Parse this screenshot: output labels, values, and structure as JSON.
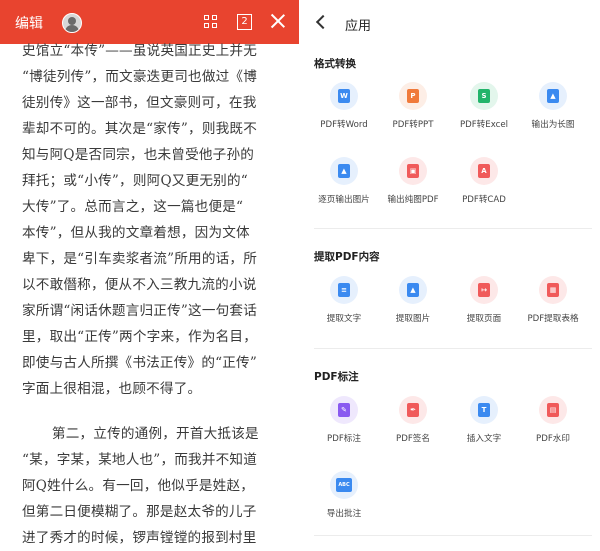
{
  "left": {
    "edit_label": "编辑",
    "page_number": "2",
    "paragraph1": [
      "史馆立“本传”——虽说英国正史上并无",
      "“博徒列传”，而文豪迭更司也做过《博",
      "徒别传》这一部书，但文豪则可，在我",
      "辈却不可的。其次是“家传”，则我既不",
      "知与阿Q是否同宗，也未曾受他子孙的",
      "拜托；或“小传”，则阿Q又更无别的“",
      "大传”了。总而言之，这一篇也便是“",
      "本传”，但从我的文章着想，因为文体",
      "卑下，是“引车卖浆者流”所用的话，所",
      "以不敢僭称，便从不入三教九流的小说",
      "家所谓“闲话休题言归正传”这一句套话",
      "里，取出“正传”两个字来，作为名目，",
      "即使与古人所撰《书法正传》的“正传”",
      "字面上很相混，也顾不得了。"
    ],
    "paragraph2": [
      "第二，立传的通例，开首大抵该是",
      "“某，字某，某地人也”，而我并不知道",
      "阿Q姓什么。有一回，他似乎是姓赵，",
      "但第二日便模糊了。那是赵太爷的儿子",
      "进了秀才的时候，锣声镗镗的报到村里"
    ]
  },
  "right": {
    "title": "应用",
    "sections": [
      {
        "title": "格式转换",
        "tools": [
          {
            "label": "PDF转Word",
            "icon": "word-doc-icon",
            "glyph": "W",
            "color": "#3b8af0",
            "bg": "#e6f0fd"
          },
          {
            "label": "PDF转PPT",
            "icon": "ppt-doc-icon",
            "glyph": "P",
            "color": "#f07a3b",
            "bg": "#fdeee6"
          },
          {
            "label": "PDF转Excel",
            "icon": "excel-doc-icon",
            "glyph": "S",
            "color": "#22b46a",
            "bg": "#e3f6ec"
          },
          {
            "label": "输出为长图",
            "icon": "long-image-icon",
            "glyph": "▲",
            "color": "#3b8af0",
            "bg": "#e6f0fd"
          },
          {
            "label": "逐页输出图片",
            "icon": "page-images-icon",
            "glyph": "▲",
            "color": "#3b8af0",
            "bg": "#e6f0fd"
          },
          {
            "label": "输出纯图PDF",
            "icon": "image-pdf-icon",
            "glyph": "▣",
            "color": "#f05a5a",
            "bg": "#fde8e8"
          },
          {
            "label": "PDF转CAD",
            "icon": "cad-doc-icon",
            "glyph": "A",
            "color": "#f05a5a",
            "bg": "#fde8e8"
          }
        ]
      },
      {
        "title": "提取PDF内容",
        "tools": [
          {
            "label": "提取文字",
            "icon": "extract-text-icon",
            "glyph": "≡",
            "color": "#3b8af0",
            "bg": "#e6f0fd"
          },
          {
            "label": "提取图片",
            "icon": "extract-image-icon",
            "glyph": "▲",
            "color": "#3b8af0",
            "bg": "#e6f0fd"
          },
          {
            "label": "提取页面",
            "icon": "extract-page-icon",
            "glyph": "↦",
            "color": "#f05a5a",
            "bg": "#fde8e8"
          },
          {
            "label": "PDF提取表格",
            "icon": "extract-table-icon",
            "glyph": "▦",
            "color": "#f05a5a",
            "bg": "#fde8e8"
          }
        ]
      },
      {
        "title": "PDF标注",
        "tools": [
          {
            "label": "PDF标注",
            "icon": "annotate-icon",
            "glyph": "✎",
            "color": "#8a5af0",
            "bg": "#efe8fd"
          },
          {
            "label": "PDF签名",
            "icon": "signature-icon",
            "glyph": "✒",
            "color": "#f05a5a",
            "bg": "#fde8e8"
          },
          {
            "label": "插入文字",
            "icon": "insert-text-icon",
            "glyph": "T",
            "color": "#3b8af0",
            "bg": "#e6f0fd"
          },
          {
            "label": "PDF水印",
            "icon": "watermark-icon",
            "glyph": "▤",
            "color": "#f05a5a",
            "bg": "#fde8e8"
          },
          {
            "label": "导出批注",
            "icon": "export-notes-icon",
            "glyph": "ABC",
            "color": "#3b8af0",
            "bg": "#e6f0fd"
          }
        ]
      }
    ]
  }
}
